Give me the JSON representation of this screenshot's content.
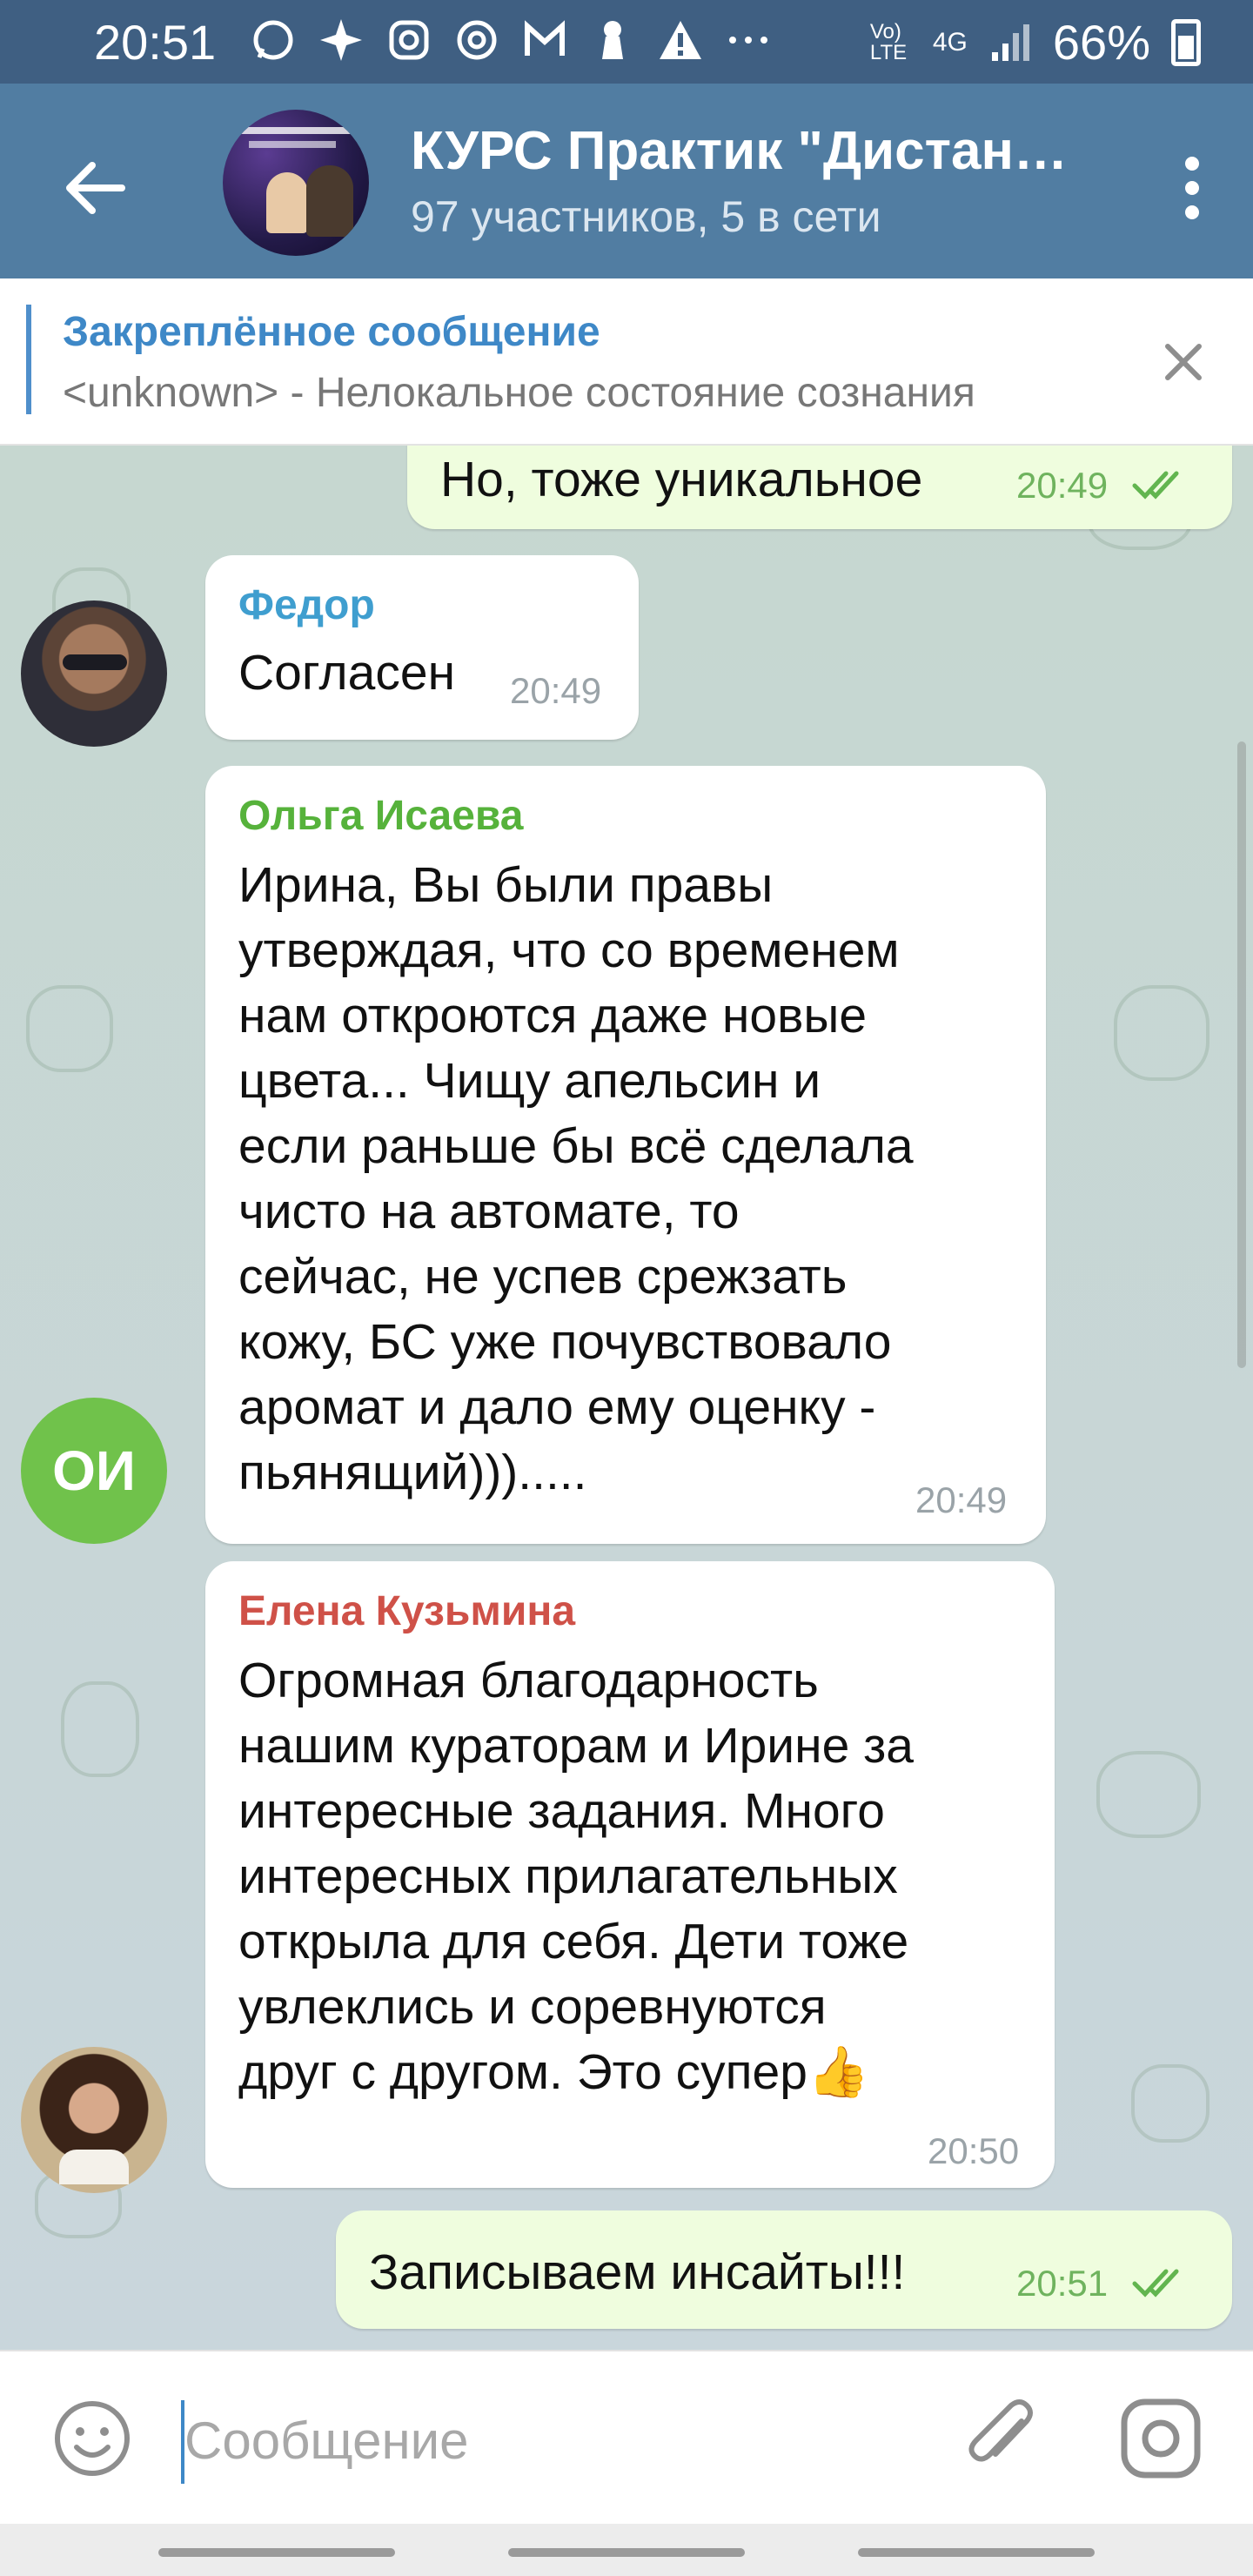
{
  "status_bar": {
    "time": "20:51",
    "network": "Vo) LTE",
    "signal_type": "4G",
    "battery": "66%",
    "icons": [
      "whatsapp-icon",
      "sparkle-icon",
      "instagram-icon",
      "at-icon",
      "gmail-icon",
      "keyhole-icon",
      "warning-icon",
      "more-dots-icon"
    ]
  },
  "header": {
    "title": "КУРС Практик \"Дистанционное видение\"",
    "subtitle": "97 участников, 5 в сети"
  },
  "pinned": {
    "label": "Закреплённое сообщение",
    "text": "<unknown> - Нелокальное состояние сознания"
  },
  "messages": [
    {
      "id": "m1",
      "direction": "out",
      "text": "Но, тоже уникальное",
      "time": "20:49",
      "read": true
    },
    {
      "id": "m2",
      "direction": "in",
      "sender": "Федор",
      "sender_color": "#3f9ecf",
      "text": "Согласен",
      "time": "20:49"
    },
    {
      "id": "m3",
      "direction": "in",
      "sender": "Ольга Исаева",
      "sender_color": "#56b23b",
      "avatar_initials": "ОИ",
      "lines": [
        "Ирина, Вы были правы",
        "утверждая, что со временем",
        "нам откроются даже новые",
        "цвета... Чищу апельсин и",
        "если раньше бы всё сделала",
        "чисто на автомате, то",
        "сейчас, не успев срежзать",
        "кожу, БС уже почувствовало",
        "аромат и дало ему оценку -",
        "пьянящий))).....",
        ""
      ],
      "time": "20:49"
    },
    {
      "id": "m4",
      "direction": "in",
      "sender": "Елена Кузьмина",
      "sender_color": "#cf5148",
      "lines": [
        "Огромная благодарность",
        "нашим кураторам и Ирине за",
        "интересные задания. Много",
        "интересных прилагательных",
        "открыла для себя. Дети тоже",
        "увлеклись и соревнуются",
        "друг с другом. Это супер👍"
      ],
      "time": "20:50"
    },
    {
      "id": "m5",
      "direction": "out",
      "text": "Записываем инсайты!!!",
      "time": "20:51",
      "read": true
    }
  ],
  "input": {
    "placeholder": "Сообщение"
  },
  "colors": {
    "header": "#517da2",
    "status_bar": "#3f5f82",
    "accent": "#3e88c7",
    "out_bubble": "#effdde"
  }
}
